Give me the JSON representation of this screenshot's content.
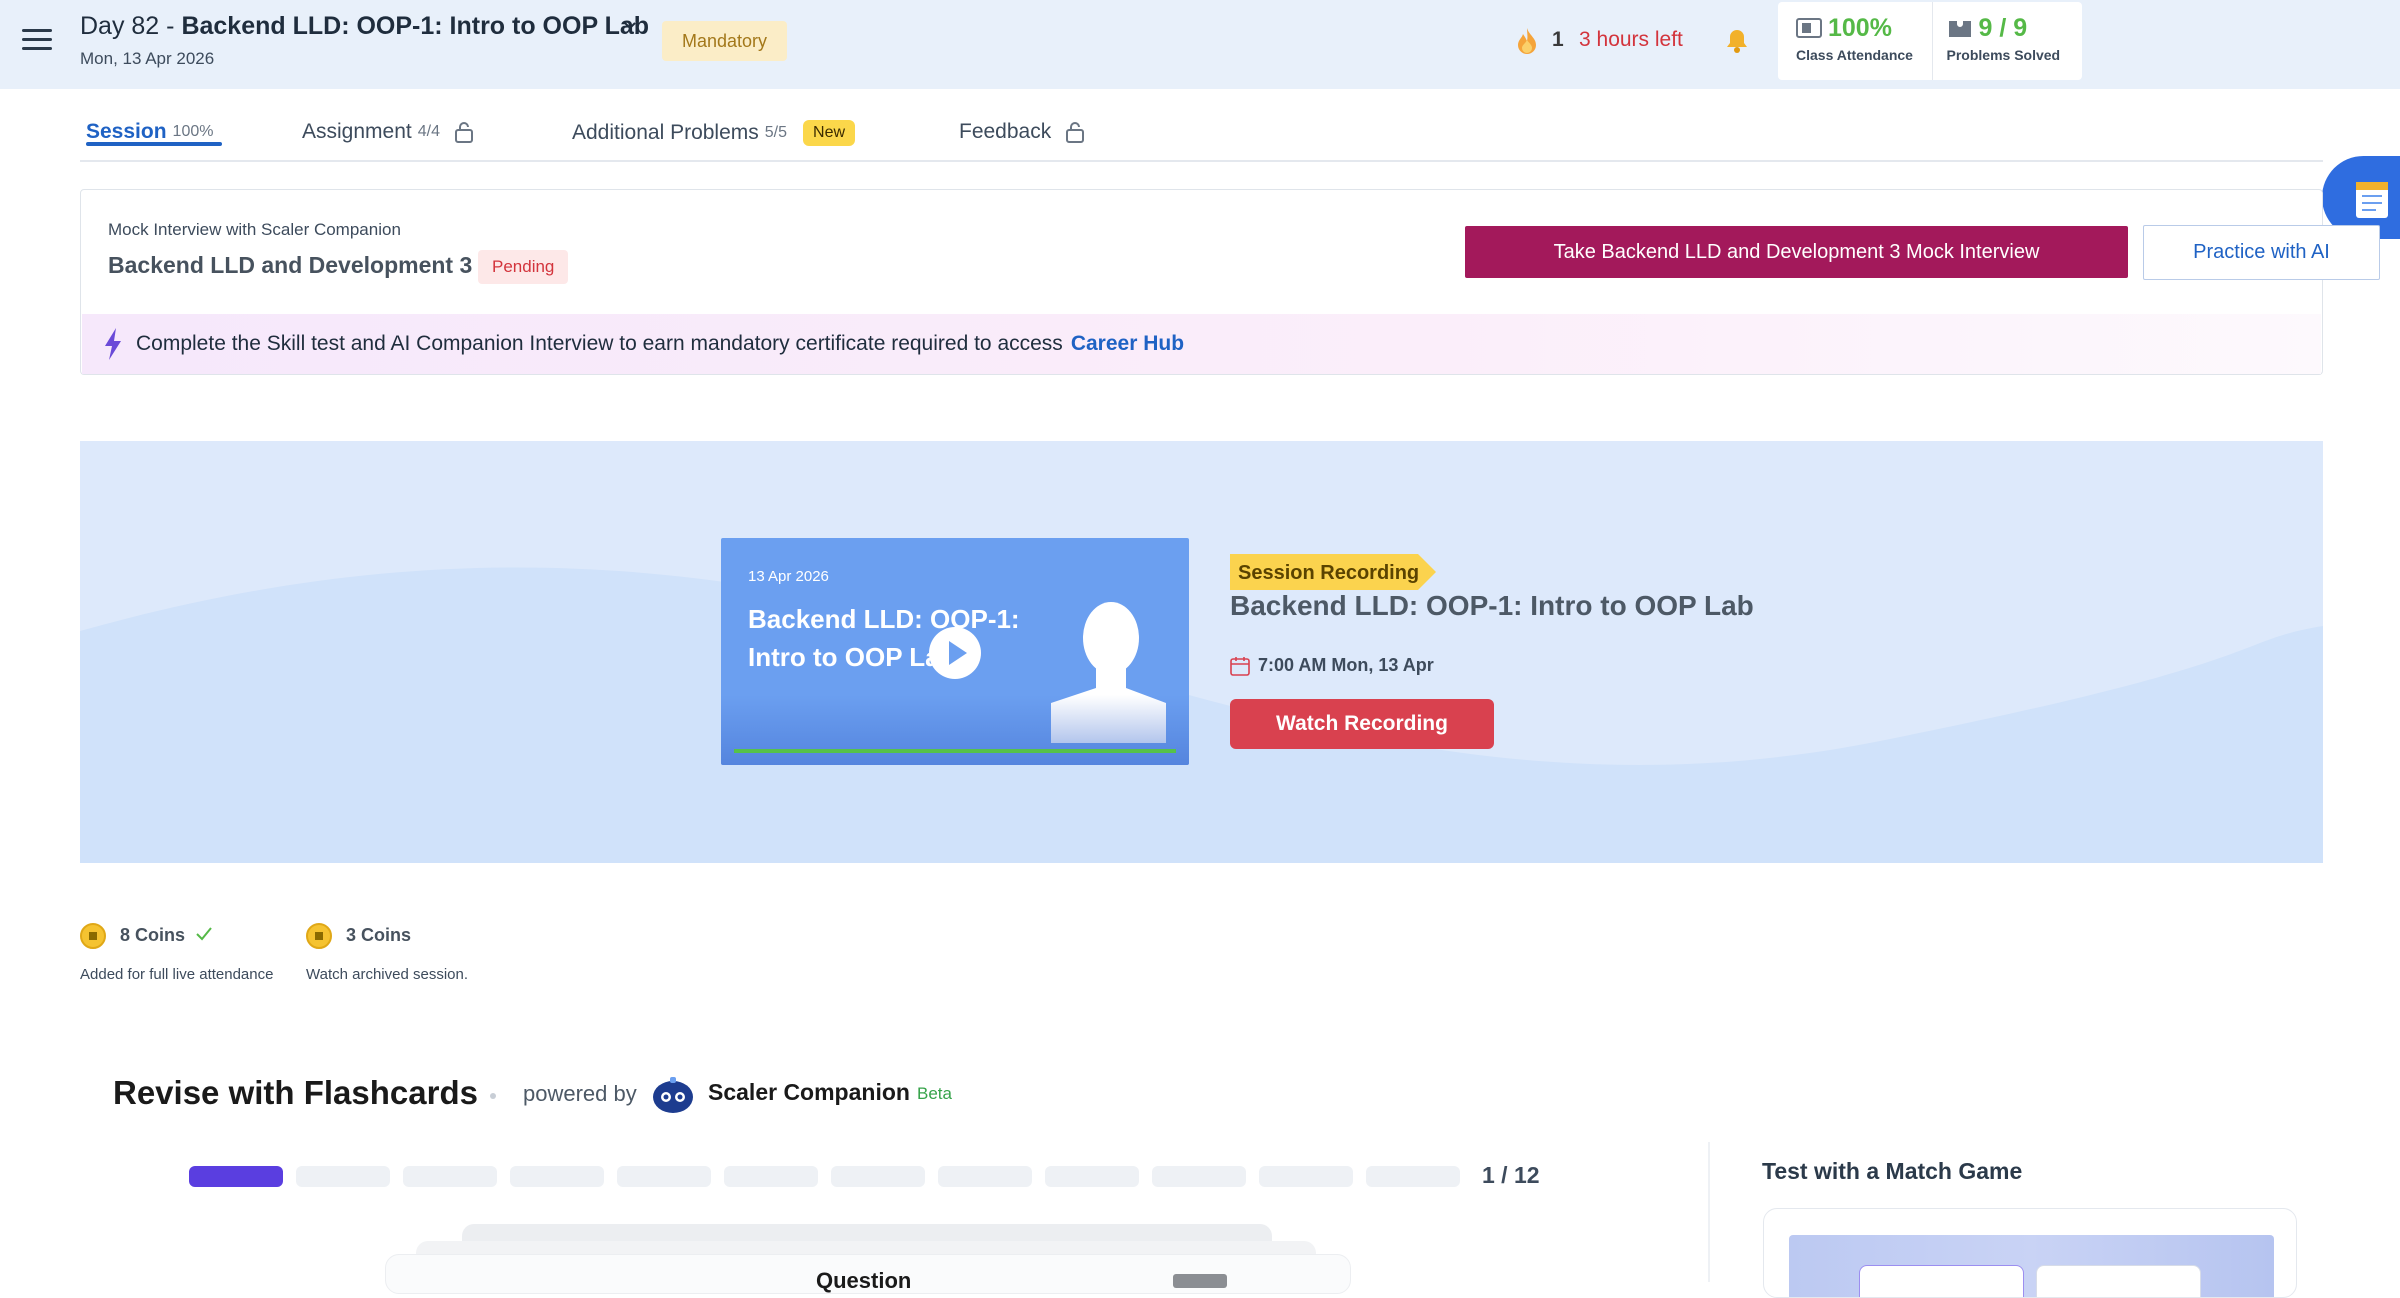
{
  "header": {
    "day_prefix": "Day 82 - ",
    "title": "Backend LLD: OOP-1: Intro to OOP Lab",
    "date": "Mon, 13 Apr 2026",
    "mandatory_badge": "Mandatory",
    "streak_count": "1",
    "time_left": "3 hours left",
    "attendance_value": "100%",
    "attendance_label": "Class Attendance",
    "problems_value": "9 / 9",
    "problems_label": "Problems Solved"
  },
  "tabs": [
    {
      "label": "Session",
      "sub": "100%",
      "active": true
    },
    {
      "label": "Assignment",
      "sub": "4/4",
      "locked": true
    },
    {
      "label": "Additional Problems",
      "sub": "5/5",
      "badge": "New"
    },
    {
      "label": "Feedback",
      "locked": true
    }
  ],
  "mock": {
    "subtitle": "Mock Interview with Scaler Companion",
    "title": "Backend LLD and Development 3",
    "status": "Pending",
    "primary_button": "Take Backend LLD and Development 3 Mock Interview",
    "secondary_button": "Practice with AI",
    "cert_text": "Complete the Skill test and AI Companion Interview to earn mandatory certificate required to access",
    "cert_link": "Career Hub"
  },
  "recording": {
    "video_date": "13 Apr 2026",
    "video_title": "Backend LLD: OOP-1: Intro to OOP Lab",
    "tag": "Session Recording",
    "title": "Backend LLD: OOP-1: Intro to OOP Lab",
    "time": "7:00 AM Mon, 13 Apr",
    "watch_button": "Watch Recording",
    "progress": 1.0
  },
  "coins": [
    {
      "value": "8 Coins",
      "note": "Added for full live attendance",
      "earned": true
    },
    {
      "value": "3 Coins",
      "note": "Watch archived session.",
      "earned": false
    }
  ],
  "flashcards": {
    "title": "Revise with Flashcards",
    "powered_by": "powered by",
    "companion": "Scaler Companion",
    "beta": "Beta",
    "total": 12,
    "current": 1,
    "counter": "1 / 12",
    "question_label": "Question"
  },
  "match_game": {
    "title": "Test with a Match Game"
  },
  "colors": {
    "accent": "#1f62c4",
    "primary_button": "#a3195b",
    "watch_button": "#d9414f",
    "success": "#55b947",
    "progress_bar": "#5a3ee0"
  }
}
